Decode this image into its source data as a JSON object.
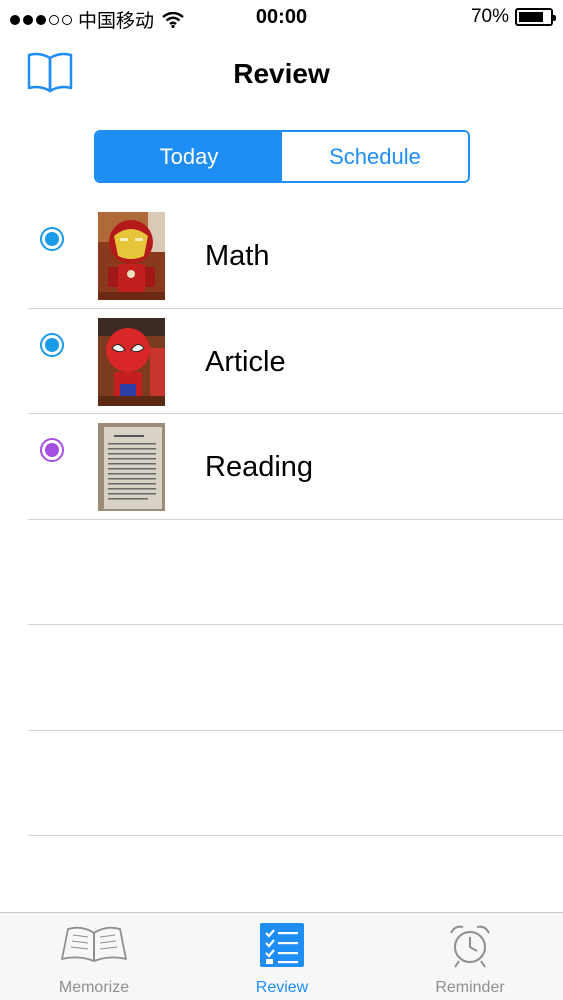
{
  "status_bar": {
    "carrier": "中国移动",
    "time": "00:00",
    "battery_percent": "70%"
  },
  "nav": {
    "title": "Review",
    "left_icon": "book-icon"
  },
  "segmented": {
    "today_label": "Today",
    "schedule_label": "Schedule",
    "selected": "Today"
  },
  "list": {
    "items": [
      {
        "label": "Math",
        "dot_color": "#1a9be6",
        "thumb": "iron-man-toy"
      },
      {
        "label": "Article",
        "dot_color": "#1a9be6",
        "thumb": "spider-man-toy"
      },
      {
        "label": "Reading",
        "dot_color": "#a54fe0",
        "thumb": "document-page"
      }
    ]
  },
  "tabbar": {
    "tabs": [
      {
        "label": "Memorize",
        "icon": "open-book-icon",
        "active": false
      },
      {
        "label": "Review",
        "icon": "checklist-icon",
        "active": true
      },
      {
        "label": "Reminder",
        "icon": "alarm-clock-icon",
        "active": false
      }
    ]
  },
  "colors": {
    "accent": "#1e8ef5",
    "dot_blue": "#1a9be6",
    "dot_purple": "#a54fe0"
  }
}
